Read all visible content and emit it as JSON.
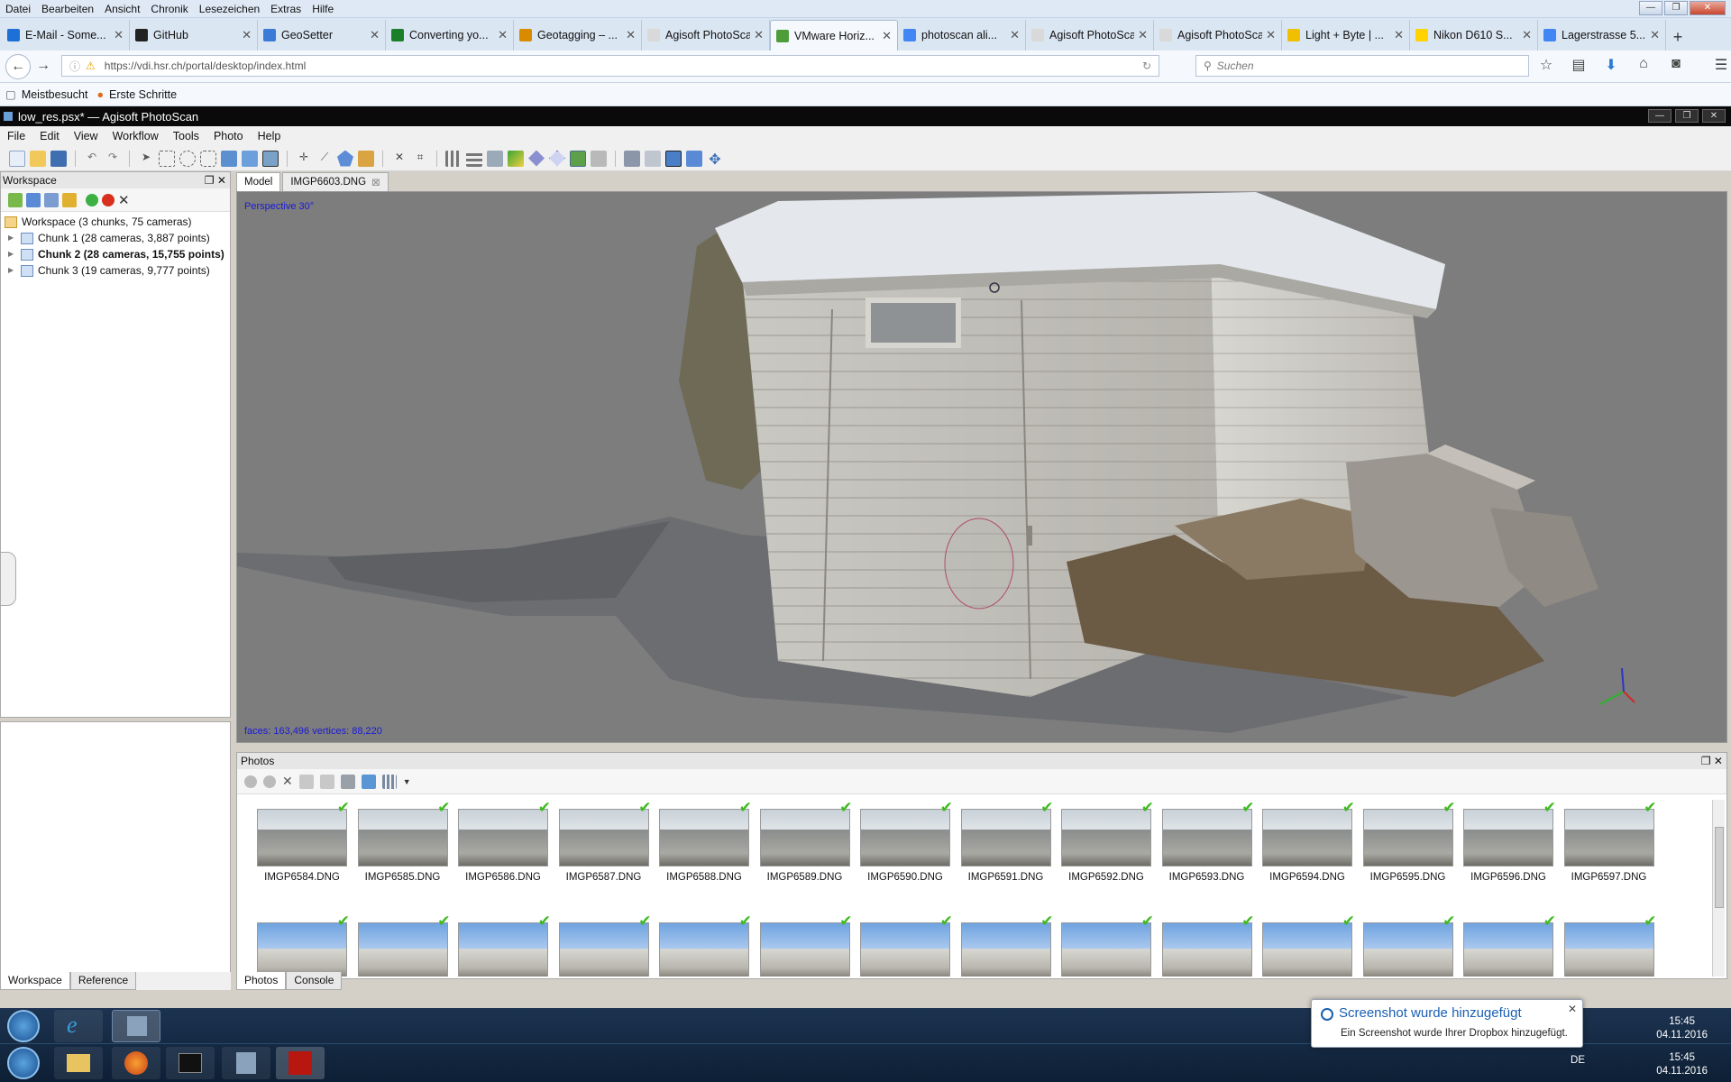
{
  "firefox": {
    "menu": [
      "Datei",
      "Bearbeiten",
      "Ansicht",
      "Chronik",
      "Lesezeichen",
      "Extras",
      "Hilfe"
    ],
    "tabs": [
      {
        "label": "E-Mail - Some...",
        "color": "#1e6fd6"
      },
      {
        "label": "GitHub",
        "color": "#222222"
      },
      {
        "label": "GeoSetter",
        "color": "#3a7bd5"
      },
      {
        "label": "Converting yo...",
        "color": "#1b7f2a"
      },
      {
        "label": "Geotagging – ...",
        "color": "#d98b00"
      },
      {
        "label": "Agisoft PhotoSca...",
        "color": "#d9d9d9"
      },
      {
        "label": "VMware Horiz...",
        "color": "#4f9d3a"
      },
      {
        "label": "photoscan ali...",
        "color": "#4285f4"
      },
      {
        "label": "Agisoft PhotoSca...",
        "color": "#d9d9d9"
      },
      {
        "label": "Agisoft PhotoSca...",
        "color": "#d9d9d9"
      },
      {
        "label": "Light + Byte | ...",
        "color": "#f0c000"
      },
      {
        "label": "Nikon D610 S...",
        "color": "#ffd200"
      },
      {
        "label": "Lagerstrasse 5...",
        "color": "#4285f4"
      }
    ],
    "active_tab": 6,
    "url": "https://vdi.hsr.ch/portal/desktop/index.html",
    "search_placeholder": "Suchen",
    "bookmarks": [
      "Meistbesucht",
      "Erste Schritte"
    ]
  },
  "photoscan": {
    "title": "low_res.psx* — Agisoft PhotoScan",
    "menu": [
      "File",
      "Edit",
      "View",
      "Workflow",
      "Tools",
      "Photo",
      "Help"
    ],
    "workspace": {
      "header": "Workspace",
      "root": "Workspace (3 chunks, 75 cameras)",
      "chunks": [
        {
          "label": "Chunk 1 (28 cameras, 3,887 points)",
          "active": false
        },
        {
          "label": "Chunk 2 (28 cameras, 15,755 points)",
          "active": true
        },
        {
          "label": "Chunk 3 (19 cameras, 9,777 points)",
          "active": false
        }
      ],
      "bottom_tabs": [
        "Workspace",
        "Reference"
      ]
    },
    "view_tabs": [
      "Model",
      "IMGP6603.DNG"
    ],
    "viewport": {
      "projection": "Perspective 30°",
      "stats": "faces: 163,496 vertices: 88,220"
    },
    "photos": {
      "header": "Photos",
      "row1": [
        "IMGP6584.DNG",
        "IMGP6585.DNG",
        "IMGP6586.DNG",
        "IMGP6587.DNG",
        "IMGP6588.DNG",
        "IMGP6589.DNG",
        "IMGP6590.DNG",
        "IMGP6591.DNG",
        "IMGP6592.DNG",
        "IMGP6593.DNG",
        "IMGP6594.DNG",
        "IMGP6595.DNG",
        "IMGP6596.DNG",
        "IMGP6597.DNG"
      ],
      "bottom_tabs": [
        "Photos",
        "Console"
      ]
    }
  },
  "taskbar": {
    "time": "15:45",
    "date": "04.11.2016",
    "lang": "DE",
    "notification": {
      "title": "Screenshot wurde hinzugefügt",
      "body": "Ein Screenshot wurde Ihrer Dropbox hinzugefügt."
    }
  }
}
